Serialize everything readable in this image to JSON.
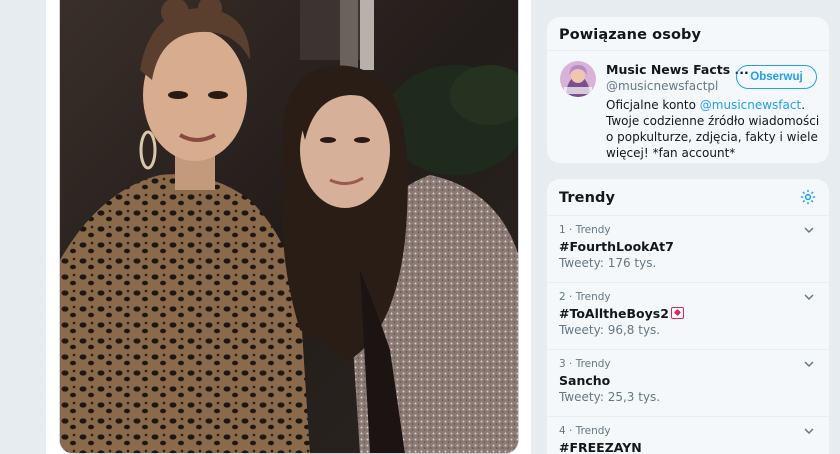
{
  "related_people": {
    "title": "Powiązane osoby",
    "person": {
      "name": "Music News Facts ...",
      "handle": "@musicnewsfactpl",
      "follow_label": "Obserwuj",
      "bio_prefix": "Oficjalne konto ",
      "bio_mention": "@musicnewsfact",
      "bio_suffix": ". Twoje codzienne źródło wiadomości o popkulturze, zdjęcia, fakty i wiele więcej! *fan account*",
      "avatar_icon": "music-news-avatar"
    }
  },
  "trends": {
    "title": "Trendy",
    "settings_icon": "gear-icon",
    "items": [
      {
        "meta": "1 · Trendy",
        "name": "#FourthLookAt7",
        "count": "Tweety: 176 tys."
      },
      {
        "meta": "2 · Trendy",
        "name": "#ToAlltheBoys2",
        "count": "Tweety: 96,8 tys.",
        "emoji": "love-letter-emoji"
      },
      {
        "meta": "3 · Trendy",
        "name": "Sancho",
        "count": "Tweety: 25,3 tys."
      },
      {
        "meta": "4 · Trendy",
        "name": "#FREEZAYN",
        "count": ""
      }
    ]
  },
  "colors": {
    "accent": "#1da1f2",
    "background": "#e6ecf0",
    "card": "#f5f8fa",
    "text": "#14171a",
    "muted": "#657786"
  }
}
